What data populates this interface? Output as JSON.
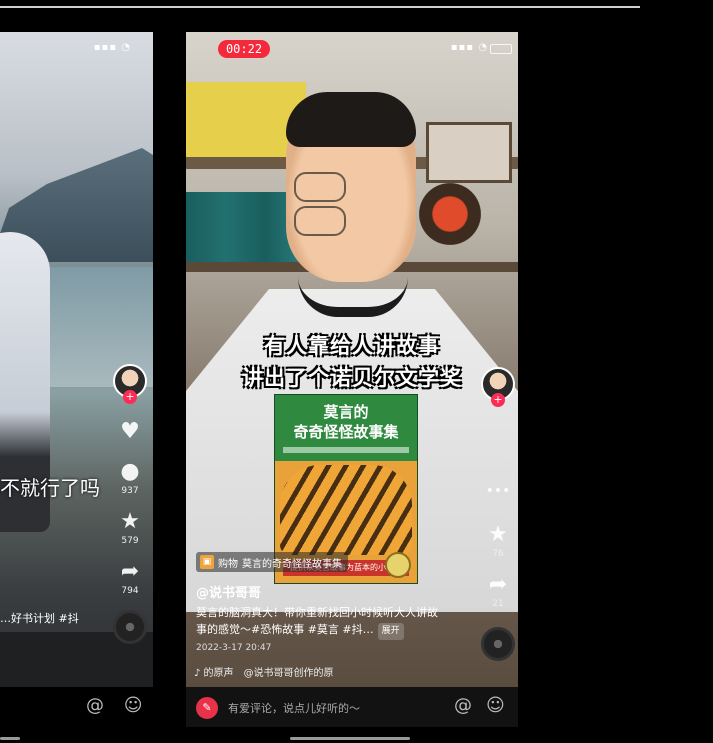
{
  "left_phone": {
    "status_icons": "▪▪▪ ◔",
    "caption": "不就行了吗",
    "subtitle": "…好书计划 #抖",
    "plus": "+",
    "actions": [
      {
        "icon": "heart-icon",
        "glyph": "♥",
        "count": ""
      },
      {
        "icon": "comment-icon",
        "glyph": "●",
        "count": "937"
      },
      {
        "icon": "star-icon",
        "glyph": "★",
        "count": "579"
      },
      {
        "icon": "share-icon",
        "glyph": "➦",
        "count": "794"
      }
    ],
    "bottom_icons": {
      "at": "@",
      "emoji": "☺"
    }
  },
  "main_phone": {
    "timer": "00:22",
    "status_icons": "▪▪▪ ◔",
    "overlay_line1": "有人靠给人讲故事",
    "overlay_line2": "讲出了个诺贝尔文学奖",
    "book": {
      "title_line1": "莫言的",
      "title_line2": "奇奇怪怪故事集",
      "badge": "提供以莫言故事为蓝本的小说集"
    },
    "plus": "+",
    "more": "•••",
    "actions": [
      {
        "icon": "star-icon",
        "glyph": "★",
        "count": "76"
      },
      {
        "icon": "share-icon",
        "glyph": "➦",
        "count": "21"
      }
    ],
    "shop_label": "购物",
    "shop_text": "莫言的奇奇怪怪故事集",
    "author": "@说书哥哥",
    "description": "莫言的脑洞真大！带你重新找回小时候听大人讲故事的感觉～#恐怖故事 #莫言 #抖…",
    "expand_label": "展开",
    "date": "2022-3-17 20:47",
    "music_label": "♪ 的原声",
    "music_source": "@说书哥哥创作的原",
    "comment_placeholder": "有爱评论，说点儿好听的～",
    "bottom_icons": {
      "at": "@",
      "emoji": "☺"
    }
  }
}
